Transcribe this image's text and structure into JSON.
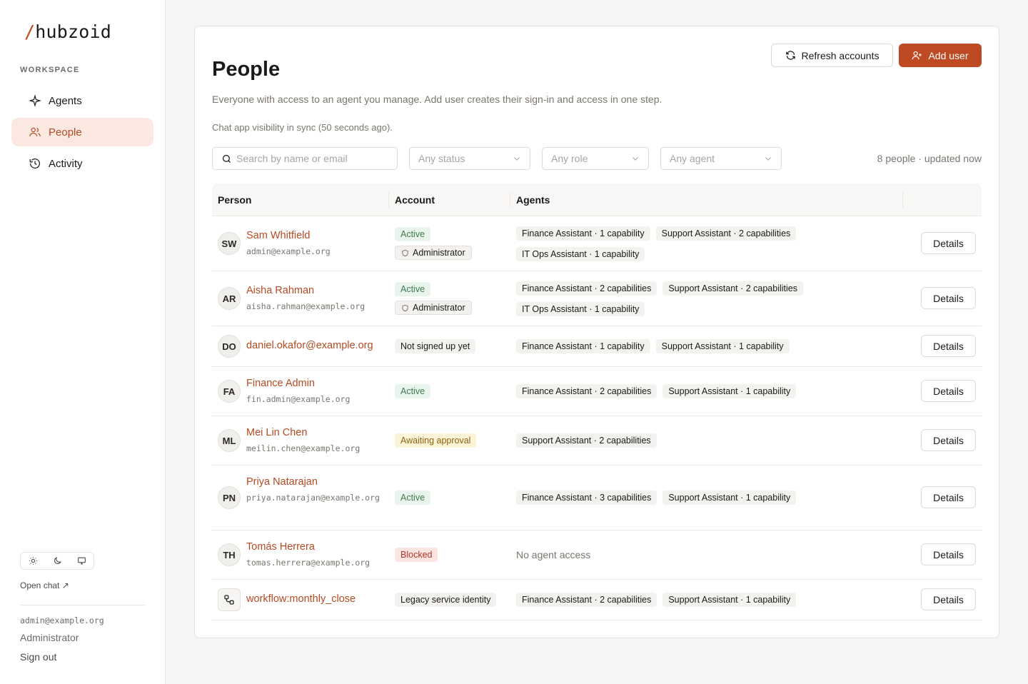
{
  "brand": {
    "slash": "/",
    "name": "hubzoid"
  },
  "sidebar": {
    "section_label": "WORKSPACE",
    "items": [
      {
        "label": "Agents",
        "icon": "sparkle-icon"
      },
      {
        "label": "People",
        "icon": "users-icon",
        "active": true
      },
      {
        "label": "Activity",
        "icon": "history-icon"
      }
    ],
    "theme_options": [
      "light",
      "dark",
      "system"
    ],
    "open_chat": "Open chat ↗",
    "user_email": "admin@example.org",
    "user_role": "Administrator",
    "sign_out": "Sign out"
  },
  "header": {
    "title": "People",
    "subtitle": "Everyone with access to an agent you manage. Add user creates their sign-in and access in one step.",
    "sync_status": "Chat app visibility in sync (50 seconds ago).",
    "refresh_label": "Refresh accounts",
    "add_user_label": "Add user"
  },
  "filters": {
    "search_placeholder": "Search by name or email",
    "status": "Any status",
    "role": "Any role",
    "agent": "Any agent",
    "count_text": "8 people · updated now"
  },
  "table": {
    "columns": [
      "Person",
      "Account",
      "Agents"
    ],
    "details_label": "Details",
    "rows": [
      {
        "initials": "SW",
        "name": "Sam Whitfield",
        "email": "admin@example.org",
        "status": "Active",
        "role": "Administrator",
        "agents": [
          "Finance Assistant · 1 capability",
          "Support Assistant · 2 capabilities",
          "IT Ops Assistant · 1 capability"
        ]
      },
      {
        "initials": "AR",
        "name": "Aisha Rahman",
        "email": "aisha.rahman@example.org",
        "status": "Active",
        "role": "Administrator",
        "agents": [
          "Finance Assistant · 2 capabilities",
          "Support Assistant · 2 capabilities",
          "IT Ops Assistant · 1 capability"
        ]
      },
      {
        "initials": "DO",
        "name": "daniel.okafor@example.org",
        "status": "Not signed up yet",
        "agents": [
          "Finance Assistant · 1 capability",
          "Support Assistant · 1 capability"
        ]
      },
      {
        "initials": "FA",
        "name": "Finance Admin",
        "email": "fin.admin@example.org",
        "status": "Active",
        "agents": [
          "Finance Assistant · 2 capabilities",
          "Support Assistant · 1 capability"
        ]
      },
      {
        "initials": "ML",
        "name": "Mei Lin Chen",
        "email": "meilin.chen@example.org",
        "status": "Awaiting approval",
        "agents": [
          "Support Assistant · 2 capabilities"
        ]
      },
      {
        "initials": "PN",
        "name": "Priya Natarajan",
        "email": "priya.natarajan@example.org",
        "status": "Active",
        "agents": [
          "Finance Assistant · 3 capabilities",
          "Support Assistant · 1 capability"
        ]
      },
      {
        "initials": "TH",
        "name": "Tomás Herrera",
        "email": "tomas.herrera@example.org",
        "status": "Blocked",
        "no_access": "No agent access"
      },
      {
        "icon": "workflow-icon",
        "name": "workflow:monthly_close",
        "status": "Legacy service identity",
        "agents": [
          "Finance Assistant · 2 capabilities",
          "Support Assistant · 1 capability"
        ]
      }
    ]
  },
  "colors": {
    "accent": "#bd4a22",
    "active_bg": "#fbe9e1",
    "page_bg": "#f6f5f3"
  }
}
